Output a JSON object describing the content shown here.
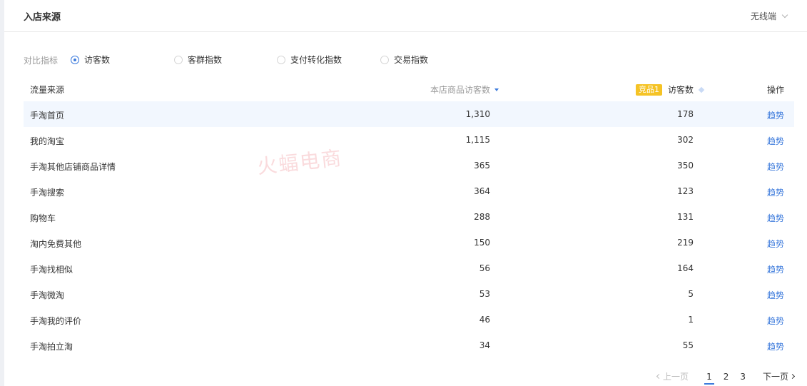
{
  "header": {
    "title": "入店来源",
    "device": "无线端"
  },
  "metrics": {
    "label": "对比指标",
    "options": [
      {
        "label": "访客数",
        "checked": true
      },
      {
        "label": "客群指数",
        "checked": false
      },
      {
        "label": "支付转化指数",
        "checked": false
      },
      {
        "label": "交易指数",
        "checked": false
      }
    ]
  },
  "watermark": "火蝠电商",
  "table": {
    "columns": {
      "source": "流量来源",
      "own": "本店商品访客数",
      "comp_badge": "竞品1",
      "comp": "访客数",
      "action": "操作"
    },
    "rows": [
      {
        "source": "手淘首页",
        "own": "1,310",
        "comp": "178",
        "action": "趋势"
      },
      {
        "source": "我的淘宝",
        "own": "1,115",
        "comp": "302",
        "action": "趋势"
      },
      {
        "source": "手淘其他店铺商品详情",
        "own": "365",
        "comp": "350",
        "action": "趋势"
      },
      {
        "source": "手淘搜索",
        "own": "364",
        "comp": "123",
        "action": "趋势"
      },
      {
        "source": "购物车",
        "own": "288",
        "comp": "131",
        "action": "趋势"
      },
      {
        "source": "淘内免费其他",
        "own": "150",
        "comp": "219",
        "action": "趋势"
      },
      {
        "source": "手淘找相似",
        "own": "56",
        "comp": "164",
        "action": "趋势"
      },
      {
        "source": "手淘微淘",
        "own": "53",
        "comp": "5",
        "action": "趋势"
      },
      {
        "source": "手淘我的评价",
        "own": "46",
        "comp": "1",
        "action": "趋势"
      },
      {
        "source": "手淘拍立淘",
        "own": "34",
        "comp": "55",
        "action": "趋势"
      }
    ]
  },
  "pager": {
    "prev": "上一页",
    "pages": [
      "1",
      "2",
      "3"
    ],
    "next": "下一页"
  },
  "colors": {
    "accent": "#3d7bdc",
    "badge": "#f5c325",
    "row_highlight": "#f2f7fe"
  }
}
